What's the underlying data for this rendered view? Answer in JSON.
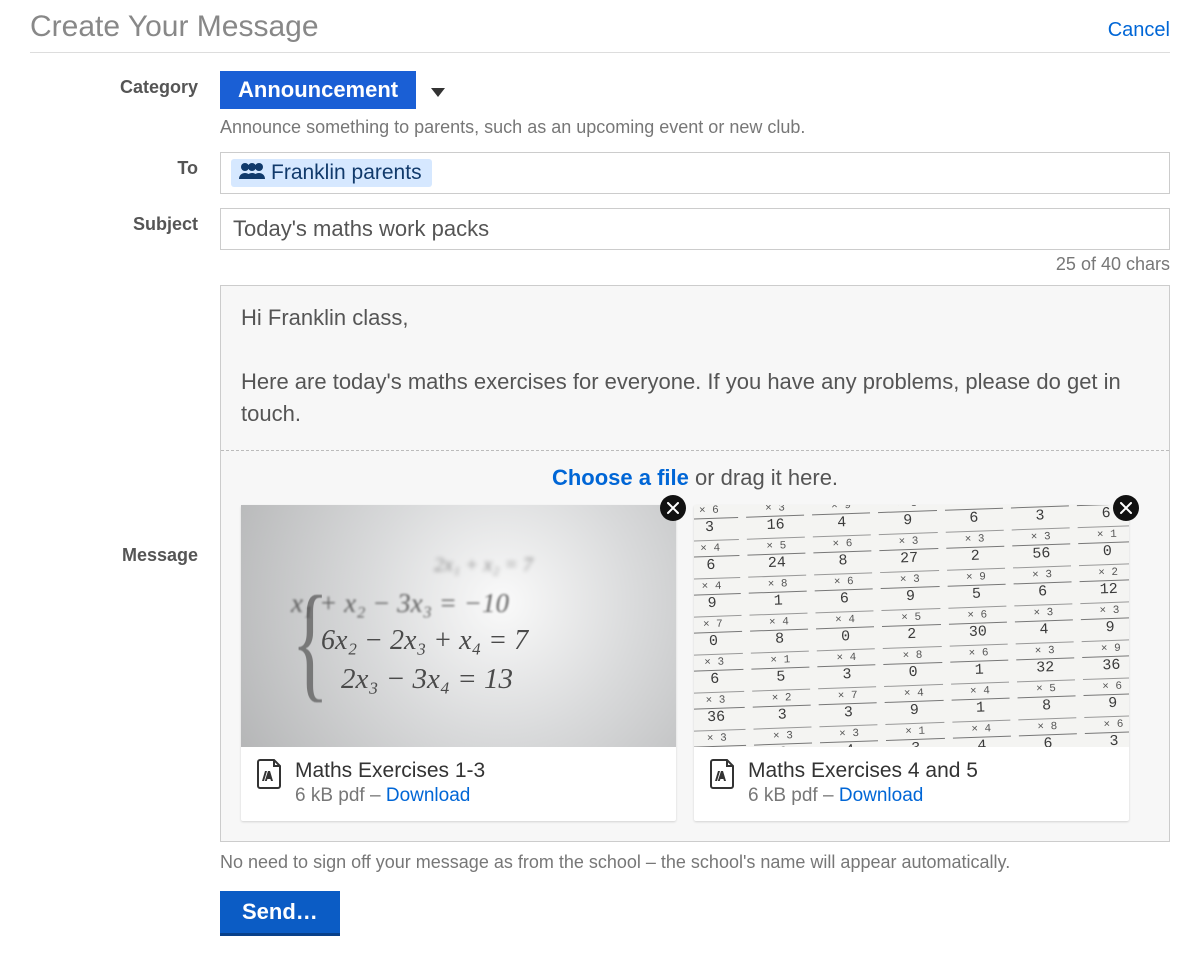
{
  "header": {
    "title": "Create Your Message",
    "cancel": "Cancel"
  },
  "category": {
    "label": "Category",
    "selected": "Announcement",
    "hint": "Announce something to parents, such as an upcoming event or new club."
  },
  "to": {
    "label": "To",
    "chip": "Franklin parents"
  },
  "subject": {
    "label": "Subject",
    "value": "Today's maths work packs",
    "counter": "25 of 40 chars"
  },
  "message": {
    "label": "Message",
    "body": "Hi Franklin class,\n\nHere are today's maths exercises for everyone. If you have any problems, please do get in touch.",
    "dropzone": {
      "choose": "Choose a file",
      "rest": " or drag it here."
    },
    "signoff_hint": "No need to sign off your message as from the school – the school's name will appear automatically."
  },
  "attachments": [
    {
      "name": "Maths Exercises 1-3",
      "size_line": "6 kB pdf – ",
      "download": "Download"
    },
    {
      "name": "Maths Exercises 4 and 5",
      "size_line": "6 kB pdf – ",
      "download": "Download"
    }
  ],
  "send": {
    "label": "Send…"
  }
}
